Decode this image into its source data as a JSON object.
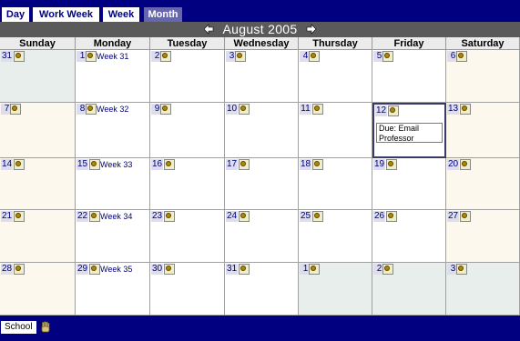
{
  "tabs": [
    {
      "label": "Day",
      "active": false
    },
    {
      "label": "Work Week",
      "active": false
    },
    {
      "label": "Week",
      "active": false
    },
    {
      "label": "Month",
      "active": true
    }
  ],
  "month": {
    "title": "August 2005",
    "prev_icon": "left-arrow-icon",
    "next_icon": "right-arrow-icon"
  },
  "weekdays": [
    "Sunday",
    "Monday",
    "Tuesday",
    "Wednesday",
    "Thursday",
    "Friday",
    "Saturday"
  ],
  "weeks": [
    {
      "label": "Week 31",
      "days": [
        "31",
        "1",
        "2",
        "3",
        "4",
        "5",
        "6"
      ]
    },
    {
      "label": "Week 32",
      "days": [
        "7",
        "8",
        "9",
        "10",
        "11",
        "12",
        "13"
      ]
    },
    {
      "label": "Week 33",
      "days": [
        "14",
        "15",
        "16",
        "17",
        "18",
        "19",
        "20"
      ]
    },
    {
      "label": "Week 34",
      "days": [
        "21",
        "22",
        "23",
        "24",
        "25",
        "26",
        "27"
      ]
    },
    {
      "label": "Week 35",
      "days": [
        "28",
        "29",
        "30",
        "31",
        "1",
        "2",
        "3"
      ]
    }
  ],
  "events": [
    {
      "week": 1,
      "day": 5,
      "text": "Due: Email Professor"
    }
  ],
  "footer": {
    "calendar_label": "School",
    "icon": "hand-icon"
  },
  "colors": {
    "background": "#000080",
    "header_bar": "#5a5a5a",
    "active_tab": "#6666b0",
    "weekend_cell": "#fdf8ee",
    "other_month_cell": "#e8eeeb"
  }
}
